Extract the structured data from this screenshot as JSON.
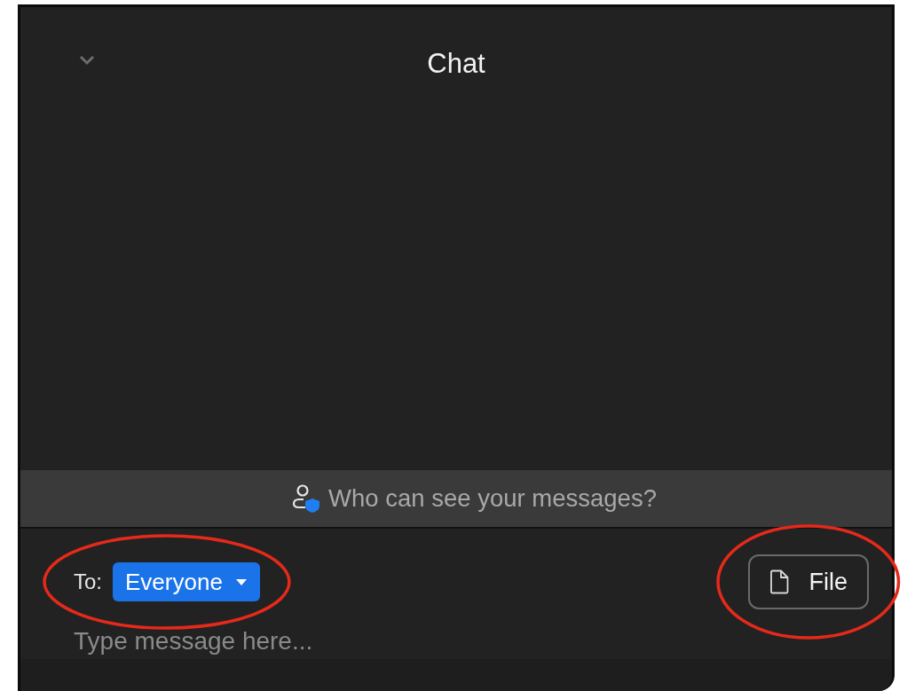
{
  "header": {
    "title": "Chat"
  },
  "privacy_banner": {
    "text": "Who can see your messages?"
  },
  "compose": {
    "to_label": "To:",
    "recipient": "Everyone",
    "recipient_circled": true,
    "file_button": {
      "label": "File",
      "circled": true
    },
    "message_field": {
      "placeholder": "Type message here..."
    }
  }
}
